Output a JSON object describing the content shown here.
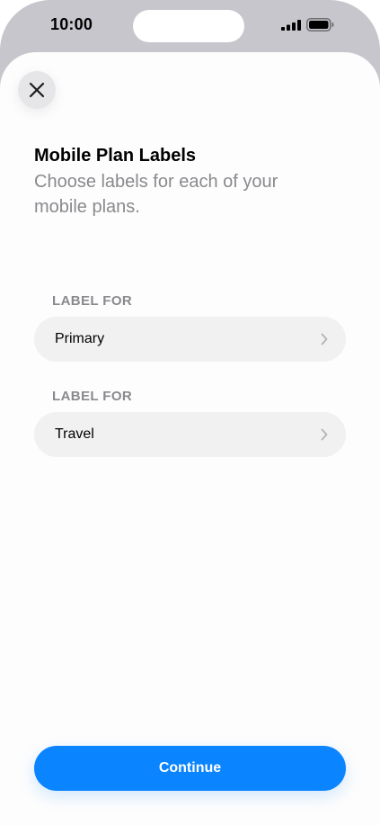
{
  "status_bar": {
    "time": "10:00",
    "signal_icon": "cellular-signal-icon",
    "battery_icon": "battery-icon"
  },
  "sheet": {
    "close_icon": "close-icon",
    "title": "Mobile Plan Labels",
    "subtitle": "Choose labels for each of your mobile plans.",
    "sections": [
      {
        "header": "LABEL FOR",
        "value": "Primary",
        "chevron_icon": "chevron-right-icon"
      },
      {
        "header": "LABEL FOR",
        "value": "Travel",
        "chevron_icon": "chevron-right-icon"
      }
    ],
    "continue_label": "Continue"
  },
  "colors": {
    "accent": "#0a84ff",
    "frame": "#c7c6cc",
    "row_background": "#f1f1f2",
    "secondary_text": "#8a8a8e"
  }
}
